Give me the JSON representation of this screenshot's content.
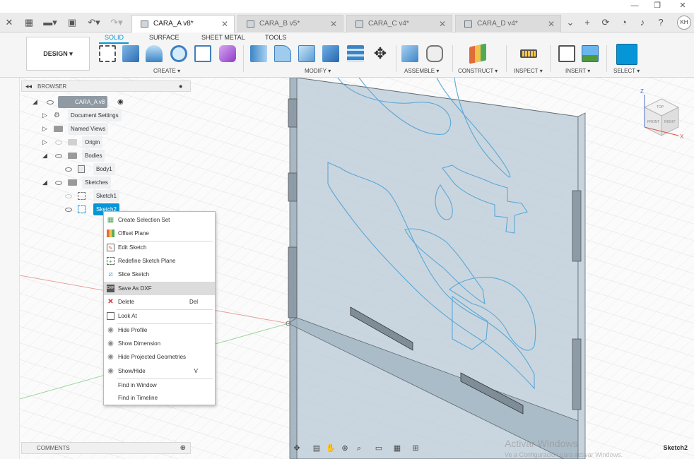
{
  "window": {
    "minimize_glyph": "—",
    "restore_glyph": "❐",
    "close_glyph": "✕"
  },
  "tabs": [
    {
      "label": "CARA_A v8*",
      "active": true
    },
    {
      "label": "CARA_B v5*",
      "active": false
    },
    {
      "label": "CARA_C v4*",
      "active": false
    },
    {
      "label": "CARA_D v4*",
      "active": false
    }
  ],
  "user_initials": "KH",
  "ribbon": {
    "tabs": [
      "SOLID",
      "SURFACE",
      "SHEET METAL",
      "TOOLS"
    ],
    "active_tab": "SOLID",
    "design_button": "DESIGN ▾",
    "groups": [
      "CREATE ▾",
      "MODIFY ▾",
      "ASSEMBLE ▾",
      "CONSTRUCT ▾",
      "INSPECT ▾",
      "INSERT ▾",
      "SELECT ▾"
    ]
  },
  "browser": {
    "title": "BROWSER",
    "root": "CARA_A v8",
    "items": [
      "Document Settings",
      "Named Views",
      "Origin",
      "Bodies",
      "Body1",
      "Sketches",
      "Sketch1",
      "Sketch2"
    ]
  },
  "context_menu": {
    "items": [
      {
        "label": "Create Selection Set",
        "icon": "selection-set-icon",
        "shortcut": ""
      },
      {
        "label": "Offset Plane",
        "icon": "offset-plane-icon",
        "shortcut": ""
      },
      {
        "label": "Edit Sketch",
        "icon": "edit-sketch-icon",
        "shortcut": ""
      },
      {
        "label": "Redefine Sketch Plane",
        "icon": "redefine-plane-icon",
        "shortcut": ""
      },
      {
        "label": "Slice Sketch",
        "icon": "slice-sketch-icon",
        "shortcut": ""
      },
      {
        "label": "Save As DXF",
        "icon": "dxf-icon",
        "shortcut": ""
      },
      {
        "label": "Delete",
        "icon": "delete-icon",
        "shortcut": "Del"
      },
      {
        "label": "Look At",
        "icon": "look-at-icon",
        "shortcut": ""
      },
      {
        "label": "Hide Profile",
        "icon": "eye-icon",
        "shortcut": ""
      },
      {
        "label": "Show Dimension",
        "icon": "eye-icon",
        "shortcut": ""
      },
      {
        "label": "Hide Projected Geometries",
        "icon": "eye-icon",
        "shortcut": ""
      },
      {
        "label": "Show/Hide",
        "icon": "eye-icon",
        "shortcut": "V"
      },
      {
        "label": "Find in Window",
        "icon": "",
        "shortcut": ""
      },
      {
        "label": "Find in Timeline",
        "icon": "",
        "shortcut": ""
      }
    ],
    "hovered": "Save As DXF"
  },
  "comments_label": "COMMENTS",
  "status_text": "Sketch2",
  "watermark": {
    "title": "Activar Windows",
    "subtitle": "Ve a Configuración para activar Windows."
  },
  "viewcube": {
    "front": "FRONT",
    "right": "RIGHT",
    "top": "TOP",
    "axis_z": "Z",
    "axis_x": "X"
  },
  "colors": {
    "accent": "#0696d7",
    "panel": "#b6c7d3",
    "sketch_line": "#5aa7d6",
    "delete_red": "#d9262f"
  }
}
